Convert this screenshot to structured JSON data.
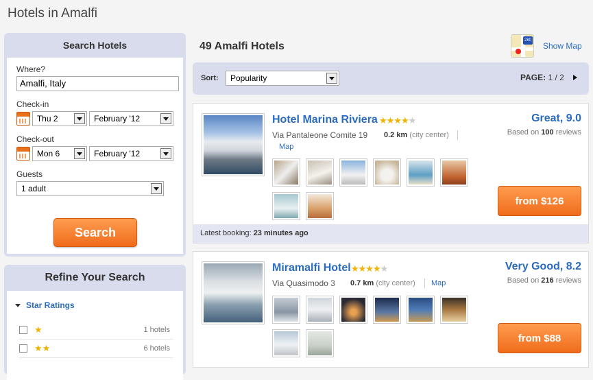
{
  "page": {
    "title": "Hotels in Amalfi"
  },
  "search_panel": {
    "heading": "Search Hotels",
    "where_label": "Where?",
    "where_value": "Amalfi, Italy",
    "checkin_label": "Check-in",
    "checkin_day": "Thu 2",
    "checkin_month": "February '12",
    "checkout_label": "Check-out",
    "checkout_day": "Mon 6",
    "checkout_month": "February '12",
    "guests_label": "Guests",
    "guests_value": "1 adult",
    "search_button": "Search"
  },
  "refine_panel": {
    "heading": "Refine Your Search",
    "star_ratings_label": "Star Ratings",
    "rows": [
      {
        "stars": "★",
        "count": "1 hotels"
      },
      {
        "stars": "★★",
        "count": "6 hotels"
      }
    ]
  },
  "results": {
    "title": "49 Amalfi Hotels",
    "show_map": "Show Map",
    "sort_label": "Sort:",
    "sort_value": "Popularity",
    "page_label": "PAGE:",
    "page_value": "1 / 2"
  },
  "hotels": [
    {
      "name": "Hotel Marina Riviera",
      "stars_on": "★★★★",
      "stars_off": "★",
      "address": "Via Pantaleone Comite 19",
      "distance": "0.2 km",
      "distance_note": "(city center)",
      "map_link": "Map",
      "rating": "Great, 9.0",
      "reviews_prefix": "Based on",
      "reviews_count": "100",
      "reviews_suffix": "reviews",
      "price": "from $126",
      "booking_prefix": "Latest booking:",
      "booking_time": "23 minutes ago"
    },
    {
      "name": "Miramalfi Hotel",
      "stars_on": "★★★★",
      "stars_off": "★",
      "address": "Via Quasimodo 3",
      "distance": "0.7 km",
      "distance_note": "(city center)",
      "map_link": "Map",
      "rating": "Very Good, 8.2",
      "reviews_prefix": "Based on",
      "reviews_count": "216",
      "reviews_suffix": "reviews",
      "price": "from $88"
    }
  ],
  "colors": {
    "link": "#2a6bbd",
    "accent": "#f06c1c",
    "panel": "#d9dcec",
    "star": "#f2b300"
  }
}
